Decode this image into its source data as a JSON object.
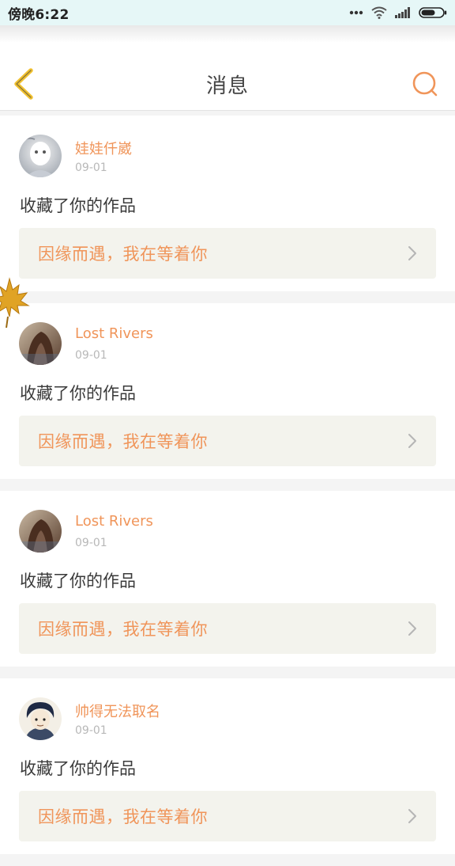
{
  "status_bar": {
    "time": "傍晚6:22",
    "icons": [
      "more-dots-icon",
      "wifi-icon",
      "signal-icon",
      "battery-icon"
    ]
  },
  "header": {
    "title": "消息",
    "back_icon": "chevron-left-icon",
    "search_icon": "search-icon"
  },
  "colors": {
    "accent": "#f0955a",
    "back_icon": "#f2c230",
    "card_link_bg": "#f3f3ed",
    "page_bg": "#f4f4f4"
  },
  "messages": [
    {
      "username": "娃娃仟崴",
      "date": "09-01",
      "action": "收藏了你的作品",
      "work_title": "因缘而遇，我在等着你"
    },
    {
      "username": "Lost Rivers",
      "date": "09-01",
      "action": "收藏了你的作品",
      "work_title": "因缘而遇，我在等着你"
    },
    {
      "username": "Lost Rivers",
      "date": "09-01",
      "action": "收藏了你的作品",
      "work_title": "因缘而遇，我在等着你"
    },
    {
      "username": "帅得无法取名",
      "date": "09-01",
      "action": "收藏了你的作品",
      "work_title": "因缘而遇，我在等着你"
    }
  ]
}
